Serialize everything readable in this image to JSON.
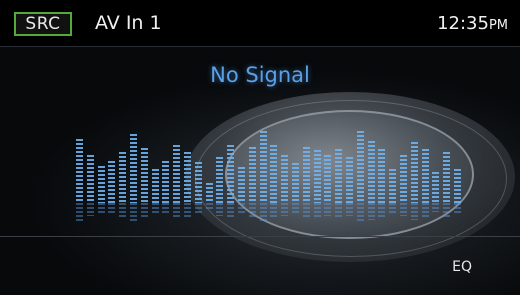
{
  "topbar": {
    "src_label": "SRC",
    "source_title": "AV In 1",
    "time": "12:35",
    "ampm": "PM"
  },
  "status": {
    "message": "No Signal"
  },
  "bottom": {
    "eq_label": "EQ"
  },
  "colors": {
    "accent_green": "#55a83c",
    "signal_blue": "#5aa0e6",
    "eq_bar_blue": "#6fb3f0"
  },
  "equalizer_levels": [
    0.58,
    0.44,
    0.34,
    0.38,
    0.46,
    0.63,
    0.5,
    0.31,
    0.38,
    0.53,
    0.46,
    0.37,
    0.18,
    0.42,
    0.53,
    0.33,
    0.51,
    0.65,
    0.53,
    0.44,
    0.36,
    0.51,
    0.48,
    0.44,
    0.49,
    0.42,
    0.65,
    0.56,
    0.49,
    0.31,
    0.44,
    0.55,
    0.49,
    0.28,
    0.46,
    0.31
  ]
}
